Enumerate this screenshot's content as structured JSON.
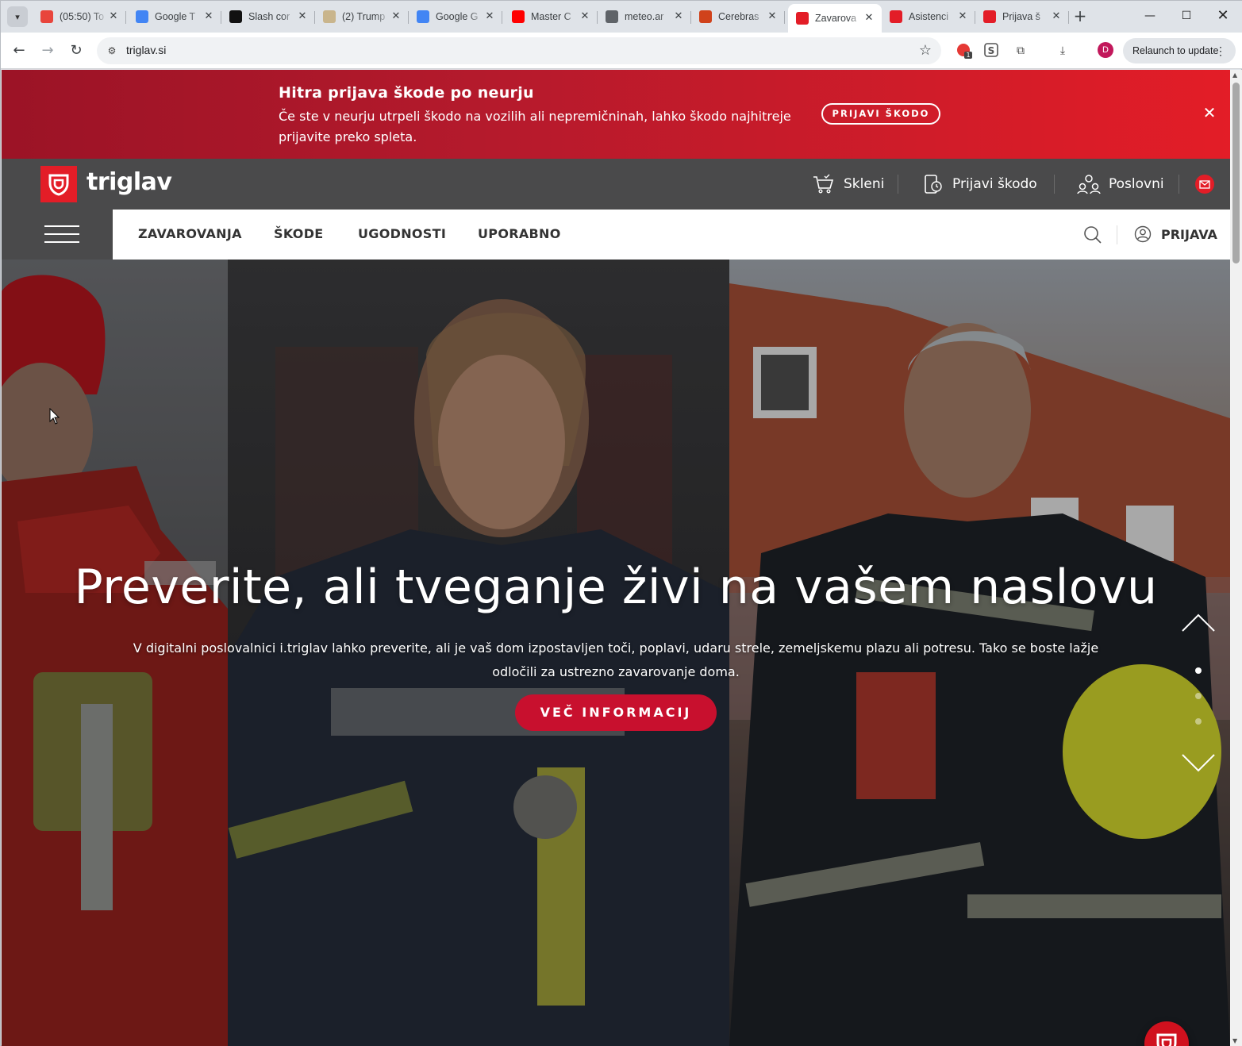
{
  "browser": {
    "tabs": [
      {
        "label": "(05:50) To",
        "favicon_color": "#e8453c"
      },
      {
        "label": "Google T",
        "favicon_color": "#4285f4"
      },
      {
        "label": "Slash cor",
        "favicon_color": "#111111"
      },
      {
        "label": "(2) Trump",
        "favicon_color": "#c9b58c"
      },
      {
        "label": "Google G",
        "favicon_color": "#4285f4"
      },
      {
        "label": "Master C",
        "favicon_color": "#ff0000"
      },
      {
        "label": "meteo.ar",
        "favicon_color": "#5f6368"
      },
      {
        "label": "Cerebras",
        "favicon_color": "#d0421b"
      },
      {
        "label": "Zavarova",
        "favicon_color": "#e31d27",
        "active": true
      },
      {
        "label": "Asistenci",
        "favicon_color": "#e31d27"
      },
      {
        "label": "Prijava š",
        "favicon_color": "#e31d27"
      }
    ],
    "url": "triglav.si",
    "relaunch_label": "Relaunch to update",
    "avatar_letter": "D",
    "extension_badge": "1"
  },
  "alert": {
    "title": "Hitra prijava škode po neurju",
    "text": "Če ste v neurju utrpeli škodo na vozilih ali nepremičninah, lahko škodo najhitreje prijavite preko spleta.",
    "button": "PRIJAVI ŠKODO"
  },
  "header": {
    "logo_text": "triglav",
    "links": [
      {
        "label": "Skleni",
        "icon": "cart-icon"
      },
      {
        "label": "Prijavi škodo",
        "icon": "phone-claim-icon"
      },
      {
        "label": "Poslovni",
        "icon": "people-icon"
      }
    ]
  },
  "nav": {
    "items": [
      "ZAVAROVANJA",
      "ŠKODE",
      "UGODNOSTI",
      "UPORABNO"
    ],
    "login": "PRIJAVA"
  },
  "hero": {
    "title": "Preverite, ali tveganje živi na vašem naslovu",
    "subtitle": "V digitalni poslovalnici i.triglav lahko preverite, ali je vaš dom izpostavljen toči, poplavi, udaru strele, zemeljskemu plazu ali potresu. Tako se boste lažje odločili za ustrezno zavarovanje doma.",
    "button": "VEČ INFORMACIJ",
    "slide_count": 3,
    "active_slide": 1
  },
  "colors": {
    "brand_red": "#e31d27",
    "header_gray": "#4a4a4b"
  }
}
